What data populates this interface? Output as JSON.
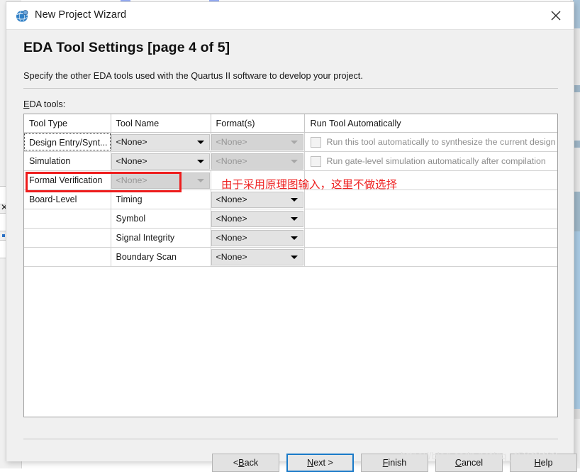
{
  "window": {
    "title": "New Project Wizard",
    "icon": "quartus-globe-icon",
    "close_label": "✕"
  },
  "page": {
    "heading": "EDA Tool Settings [page 4 of 5]",
    "description": "Specify the other EDA tools used with the Quartus II software to develop your project.",
    "list_label_accel": "E",
    "list_label_rest": "DA tools:"
  },
  "table": {
    "headers": [
      "Tool Type",
      "Tool Name",
      "Format(s)",
      "Run Tool Automatically"
    ],
    "rows": [
      {
        "tool_type": "Design Entry/Synt...",
        "tool_type_style": "dotted",
        "tool_name": "<None>",
        "tool_name_state": "enabled",
        "format": "<None>",
        "format_state": "disabled",
        "run_label": "Run this tool automatically to synthesize the current design",
        "run_checked": false
      },
      {
        "tool_type": "Simulation",
        "tool_type_style": "plain",
        "tool_name": "<None>",
        "tool_name_state": "enabled",
        "format": "<None>",
        "format_state": "disabled",
        "run_label": "Run gate-level simulation automatically after compilation",
        "run_checked": false
      },
      {
        "tool_type": "Formal Verification",
        "tool_type_style": "plain",
        "tool_name": "<None>",
        "tool_name_state": "disabled",
        "format": "",
        "format_state": "none",
        "run_label": "",
        "run_checked": null
      },
      {
        "tool_type": "Board-Level",
        "tool_type_style": "plain",
        "tool_name": "Timing",
        "tool_name_state": "text",
        "format": "<None>",
        "format_state": "enabled",
        "run_label": "",
        "run_checked": null
      },
      {
        "tool_type": "",
        "tool_type_style": "plain",
        "tool_name": "Symbol",
        "tool_name_state": "text",
        "format": "<None>",
        "format_state": "enabled",
        "run_label": "",
        "run_checked": null
      },
      {
        "tool_type": "",
        "tool_type_style": "plain",
        "tool_name": "Signal Integrity",
        "tool_name_state": "text",
        "format": "<None>",
        "format_state": "enabled",
        "run_label": "",
        "run_checked": null
      },
      {
        "tool_type": "",
        "tool_type_style": "plain",
        "tool_name": "Boundary Scan",
        "tool_name_state": "text",
        "format": "<None>",
        "format_state": "enabled",
        "run_label": "",
        "run_checked": null
      }
    ]
  },
  "annotation": {
    "text": "由于采用原理图输入，这里不做选择",
    "color": "#ee2222",
    "highlight_target": "Simulation"
  },
  "footer": {
    "buttons": [
      {
        "name": "back",
        "prefix": "< ",
        "accel": "B",
        "suffix": "ack",
        "default": false
      },
      {
        "name": "next",
        "prefix": "",
        "accel": "N",
        "suffix": "ext >",
        "default": true
      },
      {
        "name": "finish",
        "prefix": "",
        "accel": "F",
        "suffix": "inish",
        "default": false
      },
      {
        "name": "cancel",
        "prefix": "",
        "accel": "C",
        "suffix": "ancel",
        "default": false
      },
      {
        "name": "help",
        "prefix": "",
        "accel": "H",
        "suffix": "elp",
        "default": false
      }
    ]
  },
  "watermark": "https://blog.csdn.net/qq_45248462"
}
